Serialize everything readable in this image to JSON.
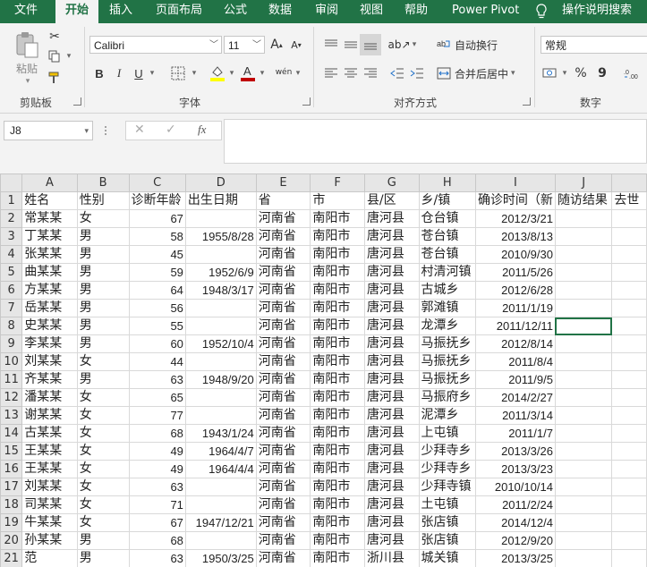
{
  "tabs": [
    "文件",
    "开始",
    "插入",
    "页面布局",
    "公式",
    "数据",
    "审阅",
    "视图",
    "帮助",
    "Power Pivot",
    "操作说明搜索"
  ],
  "active_tab": "开始",
  "ribbon": {
    "clipboard": {
      "paste": "粘贴",
      "group": "剪贴板"
    },
    "font": {
      "name": "Calibri",
      "size": "11",
      "bold": "B",
      "italic": "I",
      "underline": "U",
      "grow": "A",
      "shrink": "A",
      "phonetic": "wén",
      "group": "字体"
    },
    "alignment": {
      "wrap": "自动换行",
      "merge": "合并后居中",
      "group": "对齐方式"
    },
    "number": {
      "format": "常规",
      "percent": "%",
      "comma": "9",
      "group": "数字"
    }
  },
  "formula_bar": {
    "name_box": "J8",
    "fx": "fx",
    "content": ""
  },
  "columns": [
    "A",
    "B",
    "C",
    "D",
    "E",
    "F",
    "G",
    "H",
    "I",
    "J",
    ""
  ],
  "rows": [
    [
      "姓名",
      "性别",
      "诊断年龄",
      "出生日期",
      "省",
      "市",
      "县/区",
      "乡/镇",
      "确诊时间（新",
      "随访结果",
      "去世"
    ],
    [
      "常某某",
      "女",
      "67",
      "",
      "河南省",
      "南阳市",
      "唐河县",
      "仓台镇",
      "2012/3/21",
      "",
      ""
    ],
    [
      "丁某某",
      "男",
      "58",
      "1955/8/28",
      "河南省",
      "南阳市",
      "唐河县",
      "苍台镇",
      "2013/8/13",
      "",
      ""
    ],
    [
      "张某某",
      "男",
      "45",
      "",
      "河南省",
      "南阳市",
      "唐河县",
      "苍台镇",
      "2010/9/30",
      "",
      ""
    ],
    [
      "曲某某",
      "男",
      "59",
      "1952/6/9",
      "河南省",
      "南阳市",
      "唐河县",
      "村清河镇",
      "2011/5/26",
      "",
      ""
    ],
    [
      "方某某",
      "男",
      "64",
      "1948/3/17",
      "河南省",
      "南阳市",
      "唐河县",
      "古城乡",
      "2012/6/28",
      "",
      ""
    ],
    [
      "岳某某",
      "男",
      "56",
      "",
      "河南省",
      "南阳市",
      "唐河县",
      "郭滩镇",
      "2011/1/19",
      "",
      ""
    ],
    [
      "史某某",
      "男",
      "55",
      "",
      "河南省",
      "南阳市",
      "唐河县",
      "龙潭乡",
      "2011/12/11",
      "",
      ""
    ],
    [
      "李某某",
      "男",
      "60",
      "1952/10/4",
      "河南省",
      "南阳市",
      "唐河县",
      "马振抚乡",
      "2012/8/14",
      "",
      ""
    ],
    [
      "刘某某",
      "女",
      "44",
      "",
      "河南省",
      "南阳市",
      "唐河县",
      "马振抚乡",
      "2011/8/4",
      "",
      ""
    ],
    [
      "齐某某",
      "男",
      "63",
      "1948/9/20",
      "河南省",
      "南阳市",
      "唐河县",
      "马振抚乡",
      "2011/9/5",
      "",
      ""
    ],
    [
      "潘某某",
      "女",
      "65",
      "",
      "河南省",
      "南阳市",
      "唐河县",
      "马振府乡",
      "2014/2/27",
      "",
      ""
    ],
    [
      "谢某某",
      "女",
      "77",
      "",
      "河南省",
      "南阳市",
      "唐河县",
      "泥潭乡",
      "2011/3/14",
      "",
      ""
    ],
    [
      "古某某",
      "女",
      "68",
      "1943/1/24",
      "河南省",
      "南阳市",
      "唐河县",
      "上屯镇",
      "2011/1/7",
      "",
      ""
    ],
    [
      "王某某",
      "女",
      "49",
      "1964/4/7",
      "河南省",
      "南阳市",
      "唐河县",
      "少拜寺乡",
      "2013/3/26",
      "",
      ""
    ],
    [
      "王某某",
      "女",
      "49",
      "1964/4/4",
      "河南省",
      "南阳市",
      "唐河县",
      "少拜寺乡",
      "2013/3/23",
      "",
      ""
    ],
    [
      "刘某某",
      "女",
      "63",
      "",
      "河南省",
      "南阳市",
      "唐河县",
      "少拜寺镇",
      "2010/10/14",
      "",
      ""
    ],
    [
      "司某某",
      "女",
      "71",
      "",
      "河南省",
      "南阳市",
      "唐河县",
      "土屯镇",
      "2011/2/24",
      "",
      ""
    ],
    [
      "牛某某",
      "女",
      "67",
      "1947/12/21",
      "河南省",
      "南阳市",
      "唐河县",
      "张店镇",
      "2014/12/4",
      "",
      ""
    ],
    [
      "孙某某",
      "男",
      "68",
      "",
      "河南省",
      "南阳市",
      "唐河县",
      "张店镇",
      "2012/9/20",
      "",
      ""
    ],
    [
      "范",
      "男",
      "63",
      "1950/3/25",
      "河南省",
      "南阳市",
      "浙川县",
      "城关镇",
      "2013/3/25",
      "",
      ""
    ]
  ],
  "selected_cell": "J8",
  "colors": {
    "accent": "#217346",
    "ribbon_bg": "#f3f3f3",
    "header_bg": "#e6e6e6",
    "font_color_bar": "#c00000",
    "highlight_bar": "#ffff00"
  }
}
